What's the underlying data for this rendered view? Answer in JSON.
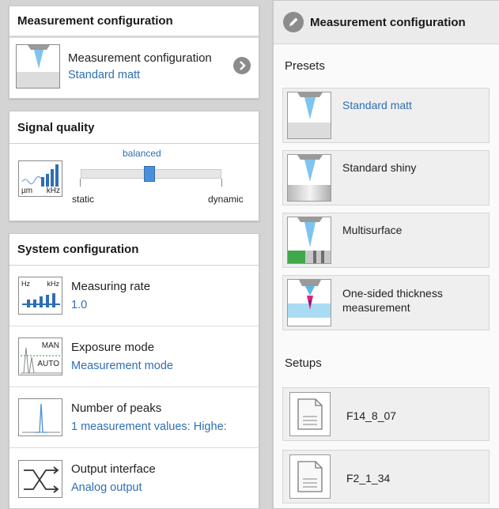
{
  "left": {
    "measurement": {
      "header": "Measurement configuration",
      "item_title": "Measurement configuration",
      "item_value": "Standard matt"
    },
    "signal": {
      "header": "Signal quality",
      "icon_um": "µm",
      "icon_khz": "kHz",
      "slider_value": "balanced",
      "slider_position": 0.5,
      "min_label": "static",
      "max_label": "dynamic"
    },
    "system": {
      "header": "System configuration",
      "items": [
        {
          "title": "Measuring rate",
          "value": "1.0",
          "icon": "measuring-rate-icon",
          "icon_hz": "Hz",
          "icon_khz": "kHz"
        },
        {
          "title": "Exposure mode",
          "value": "Measurement mode",
          "icon": "exposure-mode-icon",
          "icon_man": "MAN",
          "icon_auto": "AUTO"
        },
        {
          "title": "Number of peaks",
          "value": "1 measurement values: Highe:",
          "icon": "peaks-icon"
        },
        {
          "title": "Output interface",
          "value": "Analog output",
          "icon": "output-interface-icon"
        }
      ]
    }
  },
  "right": {
    "header": "Measurement configuration",
    "presets_label": "Presets",
    "presets": [
      {
        "label": "Standard matt",
        "selected": true,
        "icon": "standard-matt-icon"
      },
      {
        "label": "Standard shiny",
        "selected": false,
        "icon": "standard-shiny-icon"
      },
      {
        "label": "Multisurface",
        "selected": false,
        "icon": "multisurface-icon"
      },
      {
        "label_line1": "One-sided thickness",
        "label_line2": "measurement",
        "selected": false,
        "icon": "thickness-icon"
      }
    ],
    "setups_label": "Setups",
    "setups": [
      {
        "label": "F14_8_07",
        "icon": "document-icon"
      },
      {
        "label": "F2_1_34",
        "icon": "document-icon"
      }
    ]
  },
  "colors": {
    "accent_blue": "#2f6eb5",
    "slider_thumb": "#4a90d9",
    "panel_bg": "#ffffff",
    "preset_bg": "#efefef",
    "page_bg": "#d4d4d4"
  }
}
